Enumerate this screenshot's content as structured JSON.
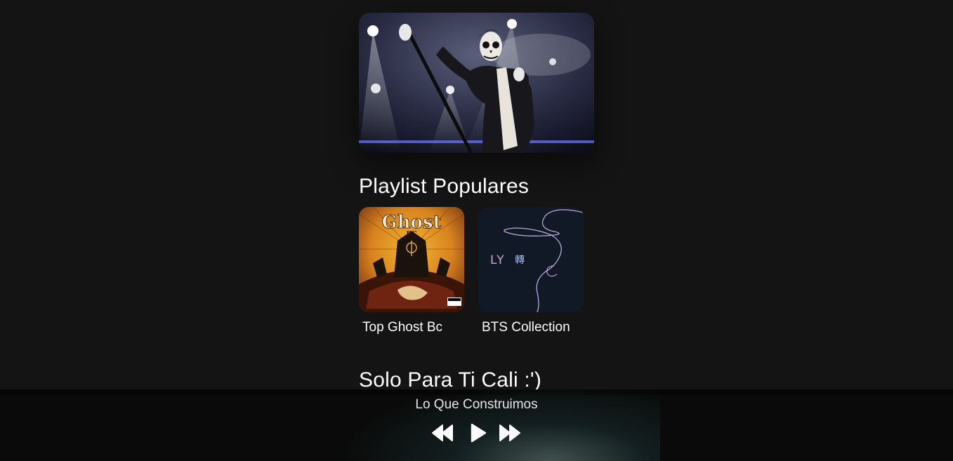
{
  "hero": {
    "image": "concert-singer-skull-makeup"
  },
  "sections": {
    "popular_title": "Playlist Populares",
    "for_you_title": "Solo Para Ti Cali :')"
  },
  "playlists": [
    {
      "label": "Top Ghost Bc",
      "art": "ghost-bc-album-art",
      "logo_text": "Ghost",
      "logo_sub": "BC"
    },
    {
      "label": "BTS Collection",
      "art": "bts-love-yourself-art",
      "logo_text": "LY 轉"
    }
  ],
  "player": {
    "track": "Lo Que Construimos",
    "controls": [
      "rewind-icon",
      "play-icon",
      "fast-forward-icon"
    ]
  },
  "colors": {
    "background": "#141414",
    "player_bg": "#0a0a0a",
    "text": "#ffffff"
  }
}
